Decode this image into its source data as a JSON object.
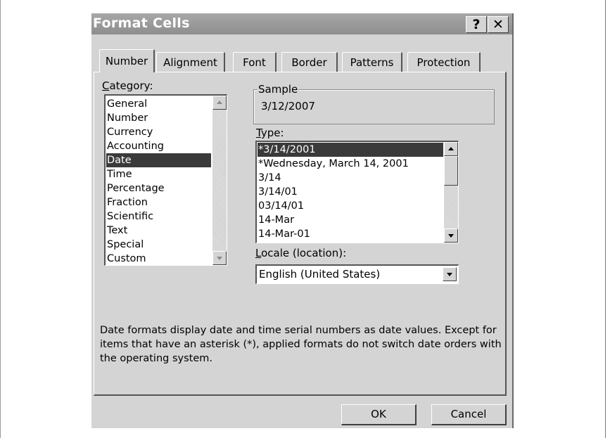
{
  "dialog": {
    "title": "Format Cells",
    "help_button": "?",
    "close_button": "✕"
  },
  "tabs": [
    {
      "label": "Number",
      "active": true
    },
    {
      "label": "Alignment",
      "active": false
    },
    {
      "label": "Font",
      "active": false
    },
    {
      "label": "Border",
      "active": false
    },
    {
      "label": "Patterns",
      "active": false
    },
    {
      "label": "Protection",
      "active": false
    }
  ],
  "category": {
    "label_first": "C",
    "label_rest": "ategory:",
    "items": [
      "General",
      "Number",
      "Currency",
      "Accounting",
      "Date",
      "Time",
      "Percentage",
      "Fraction",
      "Scientific",
      "Text",
      "Special",
      "Custom"
    ],
    "selected": "Date"
  },
  "sample": {
    "label": "Sample",
    "value": "3/12/2007"
  },
  "type": {
    "label_first": "T",
    "label_rest": "ype:",
    "items": [
      "*3/14/2001",
      "*Wednesday, March 14, 2001",
      "3/14",
      "3/14/01",
      "03/14/01",
      "14-Mar",
      "14-Mar-01"
    ],
    "selected": "*3/14/2001"
  },
  "locale": {
    "label_first": "L",
    "label_rest": "ocale (location):",
    "value": "English (United States)"
  },
  "description": "Date formats display date and time serial numbers as date values. Except for items that have an asterisk (*), applied formats do not switch date orders with the operating system.",
  "buttons": {
    "ok": "OK",
    "cancel": "Cancel"
  },
  "colors": {
    "dialog_bg": "#d4d4d4",
    "selection": "#3a3a3a",
    "titlebar": "#9a9a9a"
  }
}
